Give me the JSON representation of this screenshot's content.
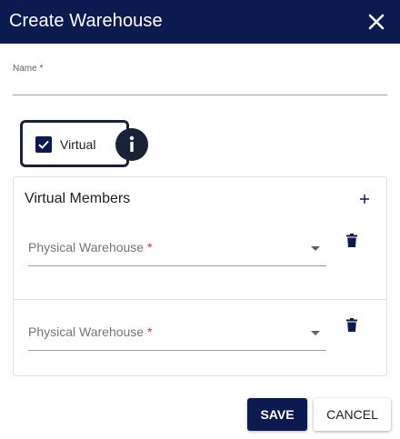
{
  "dialog": {
    "title": "Create Warehouse",
    "close_icon": "close-icon"
  },
  "form": {
    "name_label": "Name",
    "name_required_mark": "*",
    "name_value": "",
    "virtual_label": "Virtual",
    "virtual_checked": true,
    "info_icon": "info-icon"
  },
  "members": {
    "title": "Virtual Members",
    "add_icon": "plus-icon",
    "rows": [
      {
        "label": "Physical Warehouse",
        "required_mark": "*",
        "value": "",
        "delete_icon": "trash-icon"
      },
      {
        "label": "Physical Warehouse",
        "required_mark": "*",
        "value": "",
        "delete_icon": "trash-icon"
      }
    ]
  },
  "actions": {
    "save_label": "SAVE",
    "cancel_label": "CANCEL"
  },
  "colors": {
    "primary": "#0b1a4f",
    "required": "#d32f2f"
  }
}
